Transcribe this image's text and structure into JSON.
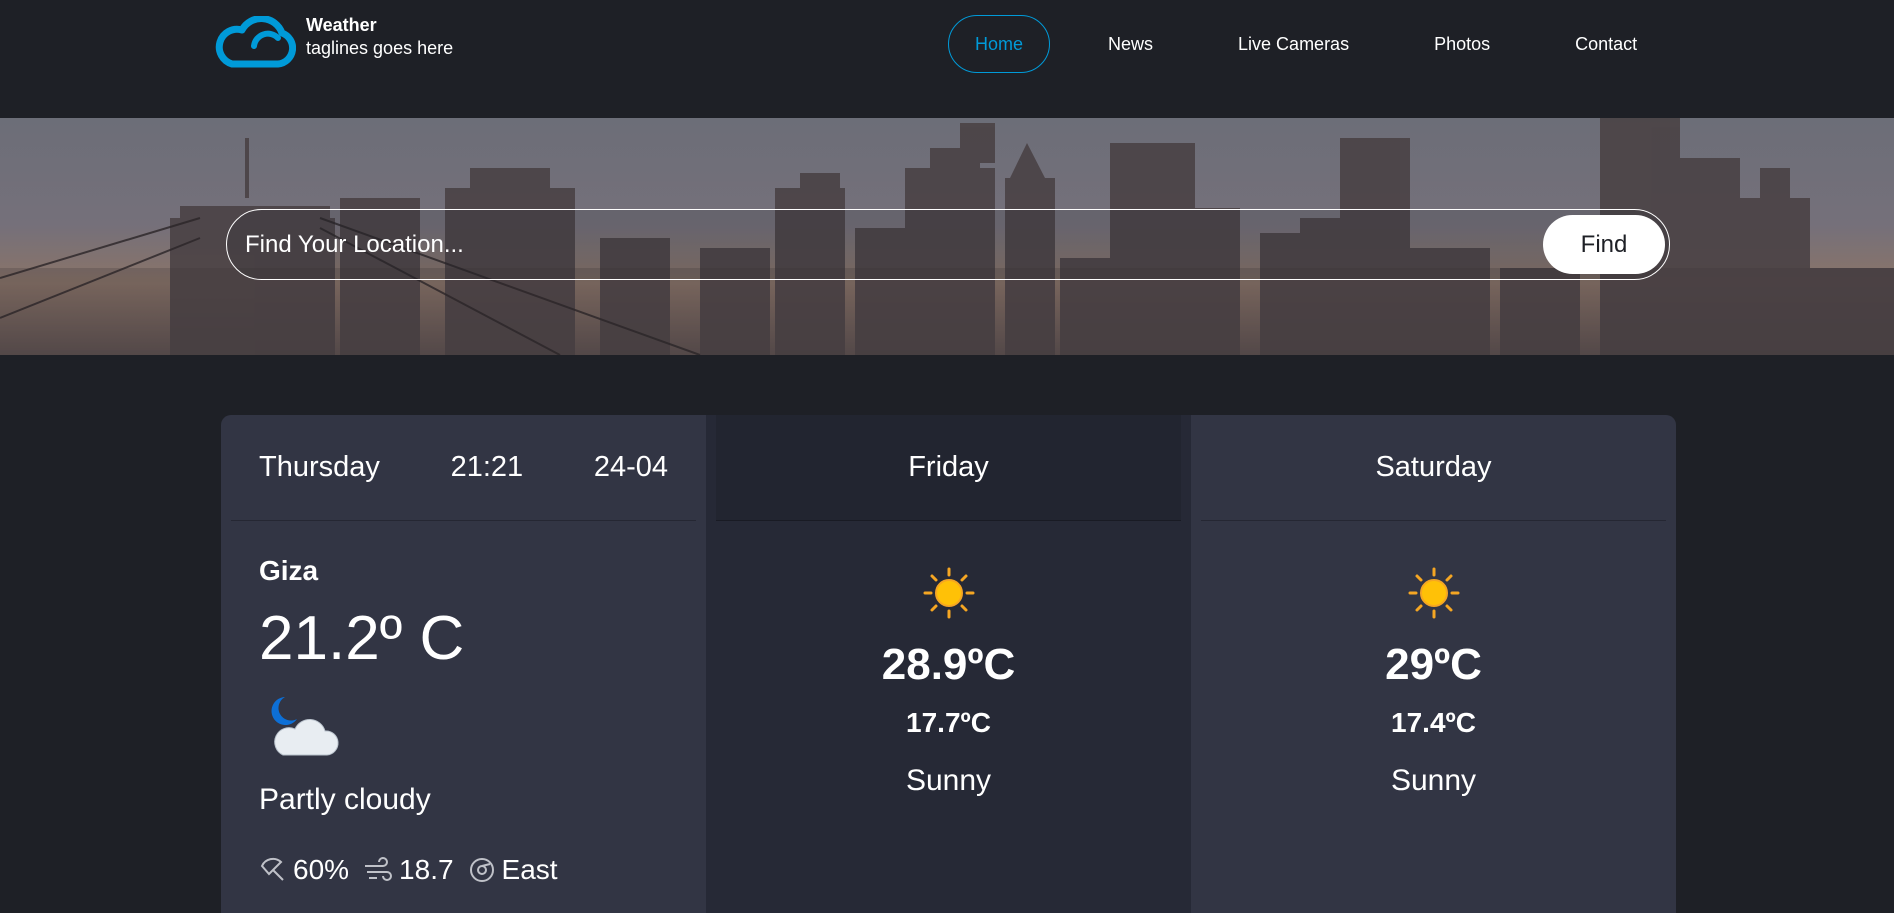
{
  "brand": {
    "name": "Weather",
    "tagline": "taglines goes here"
  },
  "nav": {
    "items": [
      "Home",
      "News",
      "Live Cameras",
      "Photos",
      "Contact"
    ],
    "active": "Home"
  },
  "search": {
    "placeholder": "Find Your Location...",
    "button_label": "Find"
  },
  "today": {
    "day": "Thursday",
    "time": "21:21",
    "date": "24-04",
    "city": "Giza",
    "temperature": "21.2º C",
    "condition": "Partly cloudy",
    "condition_icon": "moon-cloud-icon",
    "humidity": "60%",
    "wind_speed": "18.7",
    "wind_direction": "East"
  },
  "forecast": [
    {
      "day": "Friday",
      "high": "28.9ºC",
      "low": "17.7ºC",
      "condition": "Sunny",
      "icon": "sun-icon"
    },
    {
      "day": "Saturday",
      "high": "29ºC",
      "low": "17.4ºC",
      "condition": "Sunny",
      "icon": "sun-icon"
    }
  ],
  "colors": {
    "accent": "#009ad8",
    "background": "#1e2026",
    "card_light": "#323544",
    "card_dark": "#262936",
    "sun": "#ffc107"
  }
}
